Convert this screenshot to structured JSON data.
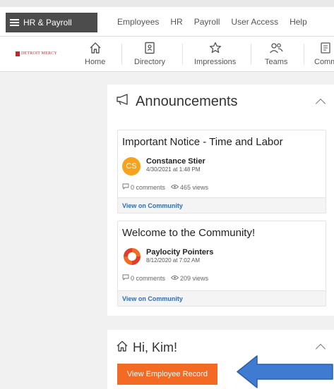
{
  "header": {
    "app_menu_label": "HR & Payroll",
    "nav": [
      "Employees",
      "HR",
      "Payroll",
      "User Access",
      "Help"
    ]
  },
  "iconbar": {
    "logo_text": "DETROIT MERCY",
    "items": [
      {
        "label": "Home",
        "icon": "home-icon"
      },
      {
        "label": "Directory",
        "icon": "directory-icon"
      },
      {
        "label": "Impressions",
        "icon": "star-icon"
      },
      {
        "label": "Teams",
        "icon": "teams-icon"
      },
      {
        "label": "Comm",
        "icon": "community-icon"
      }
    ]
  },
  "announcements": {
    "title": "Announcements",
    "items": [
      {
        "title": "Important Notice - Time and Labor",
        "author_initials": "CS",
        "author": "Constance Stier",
        "date": "4/30/2021 at 1:48 PM",
        "comments": "0 comments",
        "views": "465 views",
        "link": "View on Community"
      },
      {
        "title": "Welcome to the Community!",
        "author": "Paylocity Pointers",
        "date": "8/12/2020 at 7:02 AM",
        "comments": "0 comments",
        "views": "209 views",
        "link": "View on Community"
      }
    ]
  },
  "greeting": {
    "title": "Hi, Kim!",
    "button": "View Employee Record"
  },
  "colors": {
    "accent_orange": "#f26a24",
    "link_blue": "#2f6db3",
    "avatar_orange": "#f7a21b",
    "arrow_blue": "#3f7bd0"
  }
}
